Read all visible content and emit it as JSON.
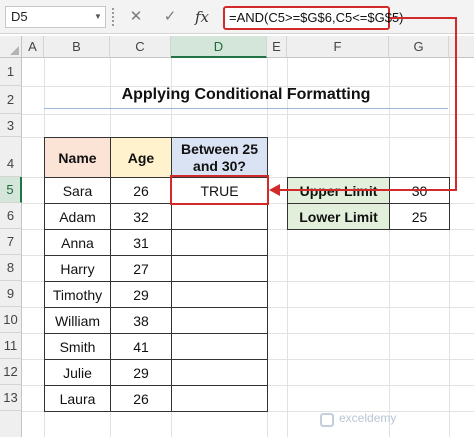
{
  "formula_bar": {
    "name_box": "D5",
    "cancel_icon": "✕",
    "enter_icon": "✓",
    "fx_label": "fx",
    "formula": "=AND(C5>=$G$6,C5<=$G$5)"
  },
  "columns": [
    "A",
    "B",
    "C",
    "D",
    "E",
    "F",
    "G"
  ],
  "rows": [
    "1",
    "2",
    "3",
    "4",
    "5",
    "6",
    "7",
    "8",
    "9",
    "10",
    "11",
    "12",
    "13"
  ],
  "selected_cell": "D5",
  "title": "Applying Conditional Formatting",
  "table": {
    "headers": {
      "name": "Name",
      "age": "Age",
      "between": "Between 25 and 30?"
    },
    "rows": [
      {
        "name": "Sara",
        "age": "26",
        "result": "TRUE"
      },
      {
        "name": "Adam",
        "age": "32",
        "result": ""
      },
      {
        "name": "Anna",
        "age": "31",
        "result": ""
      },
      {
        "name": "Harry",
        "age": "27",
        "result": ""
      },
      {
        "name": "Timothy",
        "age": "29",
        "result": ""
      },
      {
        "name": "William",
        "age": "38",
        "result": ""
      },
      {
        "name": "Smith",
        "age": "41",
        "result": ""
      },
      {
        "name": "Julie",
        "age": "29",
        "result": ""
      },
      {
        "name": "Laura",
        "age": "26",
        "result": ""
      }
    ]
  },
  "limits": {
    "upper_label": "Upper Limit",
    "upper_value": "30",
    "lower_label": "Lower Limit",
    "lower_value": "25"
  },
  "watermark": "exceldemy",
  "colors": {
    "highlight": "#d22a2a",
    "name_header": "#fbe3d6",
    "age_header": "#fff2cc",
    "between_header": "#dae3f3",
    "limit_label": "#e2efda",
    "selected_header": "#d4e5d9"
  }
}
